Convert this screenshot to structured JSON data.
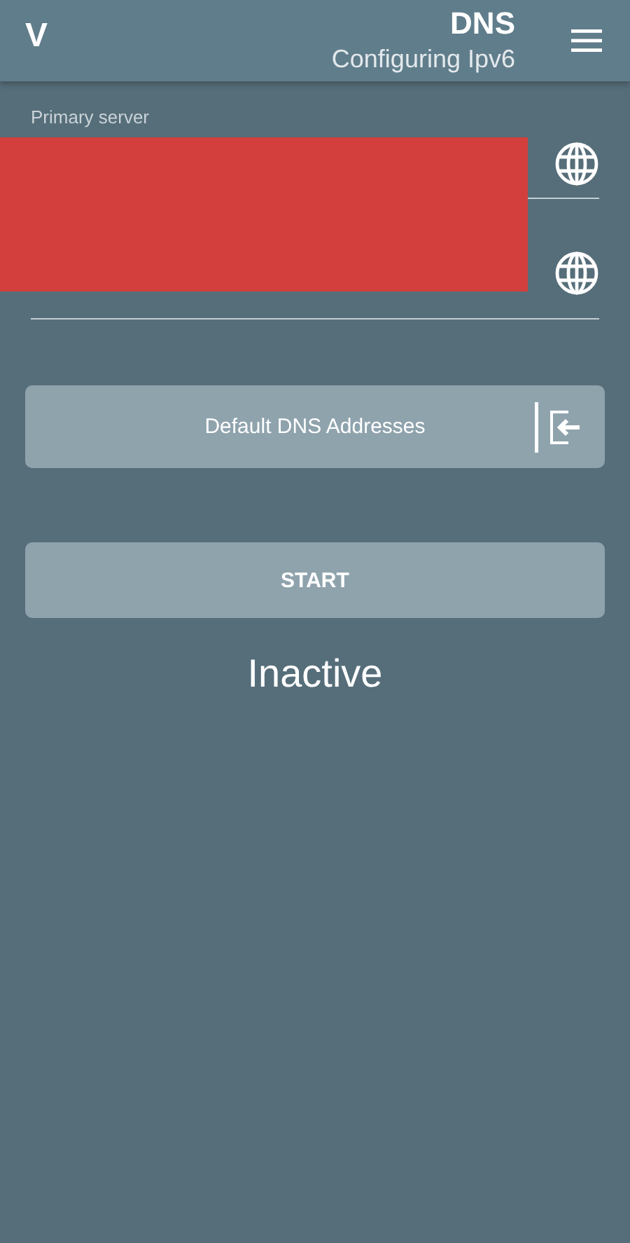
{
  "app_bar": {
    "logo_text": "V",
    "title": "DNS",
    "subtitle": "Configuring Ipv6"
  },
  "fields": [
    {
      "kind": "labeled",
      "label": "Primary server"
    },
    {
      "kind": "plain"
    }
  ],
  "redacted": true,
  "default_button": {
    "label": "Default DNS Addresses"
  },
  "start_button": {
    "label": "START"
  },
  "status": "Inactive"
}
